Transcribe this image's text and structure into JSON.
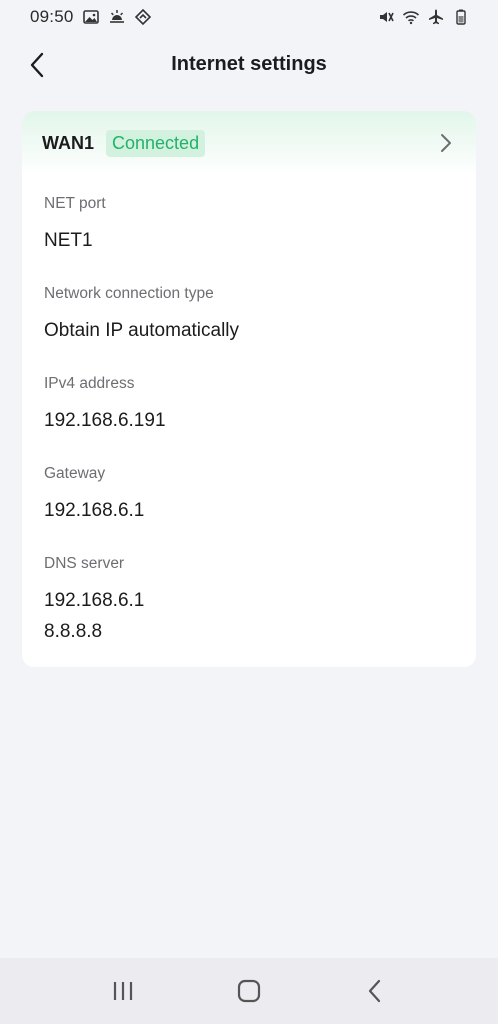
{
  "status_bar": {
    "time": "09:50",
    "left_icons": [
      "image-icon",
      "weather-sun-icon",
      "location-arrow-icon"
    ],
    "right_icons": [
      "mute-icon",
      "wifi-icon",
      "airplane-mode-icon",
      "battery-icon"
    ]
  },
  "header": {
    "title": "Internet settings",
    "back_icon": "chevron-left-icon"
  },
  "wan": {
    "name": "WAN1",
    "status": "Connected",
    "status_color": "#22b26a"
  },
  "fields": {
    "net_port": {
      "label": "NET port",
      "value": "NET1"
    },
    "connection_type": {
      "label": "Network connection type",
      "value": "Obtain IP automatically"
    },
    "ipv4": {
      "label": "IPv4 address",
      "value": "192.168.6.191"
    },
    "gateway": {
      "label": "Gateway",
      "value": "192.168.6.1"
    },
    "dns": {
      "label": "DNS server",
      "values": [
        "192.168.6.1",
        "8.8.8.8"
      ]
    }
  },
  "nav_bar": {
    "icons": [
      "recent-apps-icon",
      "home-icon",
      "back-icon"
    ]
  }
}
